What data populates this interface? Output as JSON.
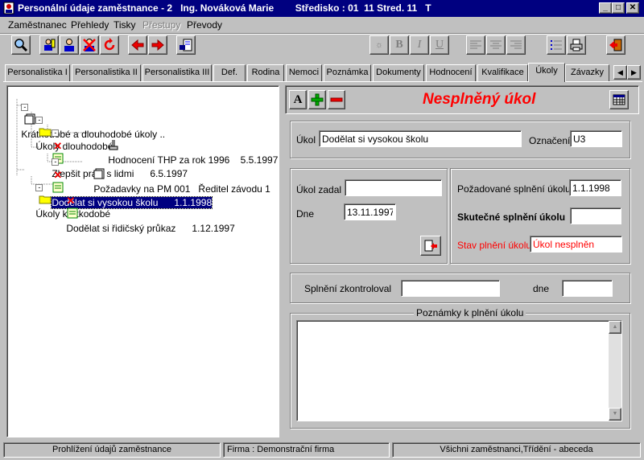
{
  "window": {
    "title": "Personální údaje zaměstnance - 2   Ing. Nováková Marie        Středisko : 01  11 Stred. 11   T"
  },
  "menu": [
    "Zaměstnanec",
    "Přehledy",
    "Tisky",
    "Přestupy",
    "Převody"
  ],
  "tabs": [
    "Personalistika I",
    "Personalistika II",
    "Personalistika III",
    "Def.",
    "Rodina",
    "Nemoci",
    "Poznámka",
    "Dokumenty",
    "Hodnocení",
    "Kvalifikace",
    "Úkoly",
    "Závazky"
  ],
  "tree": {
    "root": "Krátkodobé a dlouhodobé úkoly ..",
    "long_group": "Úkoly dlouhodobé",
    "item1": "Zlepšit práci s lidmi      6.5.1997",
    "item1_child": "Hodnocení THP za rok 1996    5.5.1997",
    "item2": "Dodělat si vysokou školu      1.1.1998",
    "item2_child": "Požadavky na PM 001   Ředitel závodu 1",
    "short_group": "Úkoly krátkodobé",
    "item3": "Dodělat si řidičský průkaz      1.12.1997"
  },
  "form": {
    "heading": "Nesplněný úkol",
    "font_button": "A",
    "ukol_label": "Úkol",
    "ukol_value": "Dodělat si vysokou školu",
    "oznaceni_label": "Označení",
    "oznaceni_value": "U3",
    "zadal_label": "Úkol zadal",
    "zadal_value": "",
    "dne_label": "Dne",
    "dne_value": "13.11.1997",
    "pozadovane_label": "Požadované splnění úkolu",
    "pozadovane_value": "1.1.1998",
    "skutecne_label": "Skutečné splnění úkolu",
    "skutecne_value": "",
    "stav_label": "Stav plnění úkolu",
    "stav_value": "Úkol nesplněn",
    "zkontroloval_label": "Splnění zkontroloval",
    "zkontroloval_value": "",
    "dne2_label": "dne",
    "dne2_value": "",
    "poznamky_label": "Poznámky k plnění úkolu"
  },
  "status": {
    "left": "Prohlížení údajů zaměstnance",
    "middle": "Firma :  Demonstrační firma",
    "right": "Všichni zaměstnanci,Třídění - abeceda"
  },
  "colors": {
    "titlebar": "#000080",
    "heading_red": "#ff0000",
    "stav_red": "#ff0000"
  }
}
